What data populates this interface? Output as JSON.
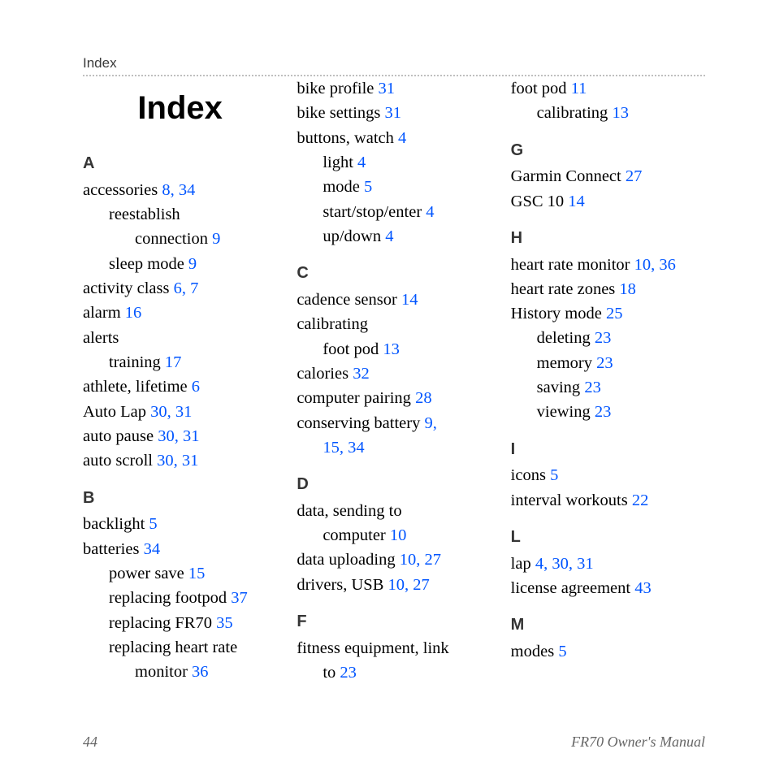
{
  "header": {
    "running": "Index",
    "title": "Index"
  },
  "footer": {
    "page": "44",
    "doc": "FR70 Owner's Manual"
  },
  "groups": [
    {
      "letter": "A",
      "first": true,
      "lines": [
        {
          "t": "accessories  ",
          "p": "8, 34",
          "lvl": 0
        },
        {
          "t": "reestablish",
          "lvl": 1,
          "wrap": true
        },
        {
          "t": "connection  ",
          "p": "9",
          "lvl": 2
        },
        {
          "t": "sleep mode  ",
          "p": "9",
          "lvl": 1
        },
        {
          "t": "activity class  ",
          "p": "6, 7",
          "lvl": 0
        },
        {
          "t": "alarm  ",
          "p": "16",
          "lvl": 0
        },
        {
          "t": "alerts",
          "lvl": 0,
          "wrap": true
        },
        {
          "t": "training  ",
          "p": "17",
          "lvl": 1
        },
        {
          "t": "athlete, lifetime  ",
          "p": "6",
          "lvl": 0
        },
        {
          "t": "Auto Lap  ",
          "p": "30, 31",
          "lvl": 0
        },
        {
          "t": "auto pause  ",
          "p": "30, 31",
          "lvl": 0
        },
        {
          "t": "auto scroll  ",
          "p": "30, 31",
          "lvl": 0
        }
      ]
    },
    {
      "letter": "B",
      "lines": [
        {
          "t": "backlight  ",
          "p": "5",
          "lvl": 0
        },
        {
          "t": "batteries  ",
          "p": "34",
          "lvl": 0
        },
        {
          "t": "power save  ",
          "p": "15",
          "lvl": 1
        },
        {
          "t": "replacing footpod  ",
          "p": "37",
          "lvl": 1
        },
        {
          "t": "replacing FR70  ",
          "p": "35",
          "lvl": 1
        },
        {
          "t": "replacing heart rate",
          "lvl": 1,
          "wrap": true
        },
        {
          "t": "monitor  ",
          "p": "36",
          "lvl": 2
        },
        {
          "t": "bike profile  ",
          "p": "31",
          "lvl": 0
        },
        {
          "t": "bike settings  ",
          "p": "31",
          "lvl": 0
        },
        {
          "t": "buttons, watch  ",
          "p": "4",
          "lvl": 0
        },
        {
          "t": "light  ",
          "p": "4",
          "lvl": 1
        },
        {
          "t": "mode  ",
          "p": "5",
          "lvl": 1
        },
        {
          "t": "start/stop/enter  ",
          "p": "4",
          "lvl": 1
        },
        {
          "t": "up/down  ",
          "p": "4",
          "lvl": 1
        }
      ]
    },
    {
      "letter": "C",
      "lines": [
        {
          "t": "cadence sensor  ",
          "p": "14",
          "lvl": 0
        },
        {
          "t": "calibrating",
          "lvl": 0,
          "wrap": true
        },
        {
          "t": "foot pod  ",
          "p": "13",
          "lvl": 1
        },
        {
          "t": "calories  ",
          "p": "32",
          "lvl": 0
        },
        {
          "t": "computer pairing  ",
          "p": "28",
          "lvl": 0
        },
        {
          "t": "conserving battery  ",
          "p": "9,",
          "lvl": 0,
          "wrap": true
        },
        {
          "t": "",
          "p": "15, 34",
          "lvl": 1
        }
      ]
    },
    {
      "letter": "D",
      "lines": [
        {
          "t": "data, sending to",
          "lvl": 0,
          "wrap": true
        },
        {
          "t": "computer  ",
          "p": "10",
          "lvl": 1
        },
        {
          "t": "data uploading  ",
          "p": "10, 27",
          "lvl": 0
        },
        {
          "t": "drivers, USB  ",
          "p": "10, 27",
          "lvl": 0
        }
      ]
    },
    {
      "letter": "F",
      "lines": [
        {
          "t": "fitness equipment, link",
          "lvl": 0,
          "wrap": true
        },
        {
          "t": "to  ",
          "p": "23",
          "lvl": 1
        },
        {
          "t": "foot pod  ",
          "p": "11",
          "lvl": 0
        },
        {
          "t": "calibrating  ",
          "p": "13",
          "lvl": 1
        }
      ]
    },
    {
      "letter": "G",
      "lines": [
        {
          "t": "Garmin Connect  ",
          "p": "27",
          "lvl": 0
        },
        {
          "t": "GSC 10  ",
          "p": "14",
          "lvl": 0
        }
      ]
    },
    {
      "letter": "H",
      "lines": [
        {
          "t": "heart rate monitor  ",
          "p": "10, 36",
          "lvl": 0
        },
        {
          "t": "heart rate zones  ",
          "p": "18",
          "lvl": 0
        },
        {
          "t": "History mode  ",
          "p": "25",
          "lvl": 0
        },
        {
          "t": "deleting  ",
          "p": "23",
          "lvl": 1
        },
        {
          "t": "memory  ",
          "p": "23",
          "lvl": 1
        },
        {
          "t": "saving  ",
          "p": "23",
          "lvl": 1
        },
        {
          "t": "viewing  ",
          "p": "23",
          "lvl": 1
        }
      ]
    },
    {
      "letter": "I",
      "lines": [
        {
          "t": "icons  ",
          "p": "5",
          "lvl": 0
        },
        {
          "t": "interval workouts  ",
          "p": "22",
          "lvl": 0
        }
      ]
    },
    {
      "letter": "L",
      "lines": [
        {
          "t": "lap  ",
          "p": "4, 30, 31",
          "lvl": 0
        },
        {
          "t": "license agreement  ",
          "p": "43",
          "lvl": 0
        }
      ]
    },
    {
      "letter": "M",
      "lines": [
        {
          "t": "modes  ",
          "p": "5",
          "lvl": 0
        }
      ]
    }
  ]
}
